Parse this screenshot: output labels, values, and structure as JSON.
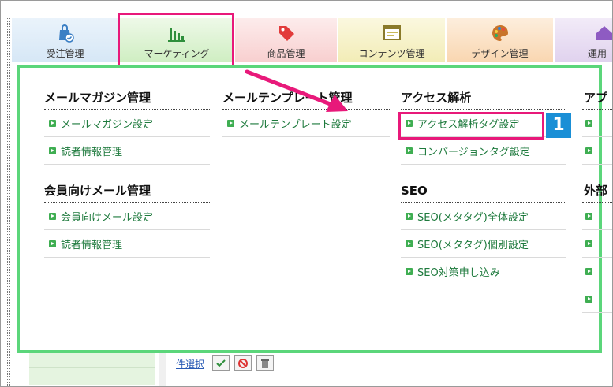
{
  "tabs": [
    {
      "label": "受注管理",
      "icon": "shopping-bag-check-icon"
    },
    {
      "label": "マーケティング",
      "icon": "bar-chart-icon"
    },
    {
      "label": "商品管理",
      "icon": "tag-icon"
    },
    {
      "label": "コンテンツ管理",
      "icon": "browser-window-icon"
    },
    {
      "label": "デザイン管理",
      "icon": "palette-icon"
    },
    {
      "label": "運用",
      "icon": "house-icon"
    }
  ],
  "menu": {
    "col1": [
      {
        "title": "メールマガジン管理",
        "items": [
          "メールマガジン設定",
          "読者情報管理"
        ]
      },
      {
        "title": "会員向けメール管理",
        "items": [
          "会員向けメール設定",
          "読者情報管理"
        ]
      }
    ],
    "col2": [
      {
        "title": "メールテンプレート管理",
        "items": [
          "メールテンプレート設定"
        ]
      }
    ],
    "col3": [
      {
        "title": "アクセス解析",
        "items": [
          "アクセス解析タグ設定",
          "コンバージョンタグ設定"
        ]
      },
      {
        "title": "SEO",
        "items": [
          "SEO(メタタグ)全体設定",
          "SEO(メタタグ)個別設定",
          "SEO対策申し込み"
        ]
      }
    ],
    "col4_titles": [
      "アプ",
      "外部"
    ]
  },
  "annotation": {
    "badge": "1"
  },
  "bottom": {
    "select_all": "件選択"
  },
  "colors": {
    "highlight": "#e8197a",
    "panel_border": "#5bd67a",
    "badge": "#1a8fd6",
    "link": "#1e7a3d"
  }
}
